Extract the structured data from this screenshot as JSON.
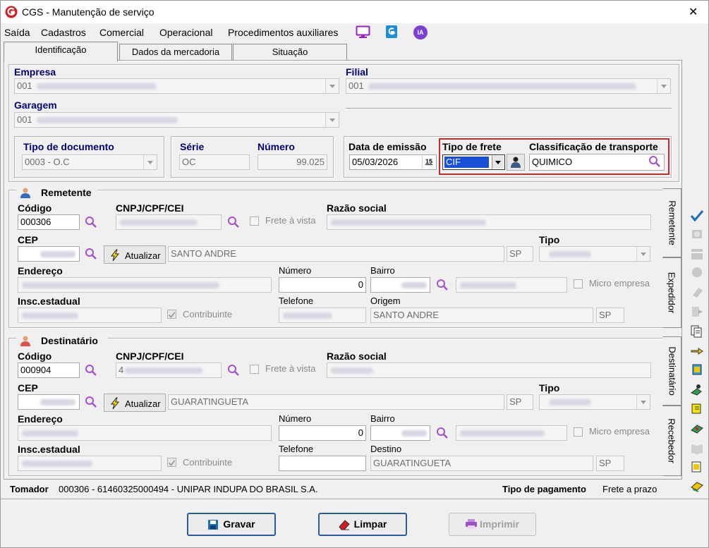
{
  "window": {
    "title": "CGS - Manutenção de serviço",
    "close": "✕"
  },
  "menu": {
    "items": [
      "Saída",
      "Cadastros",
      "Comercial",
      "Operacional",
      "Procedimentos auxiliares"
    ],
    "ia": "IA"
  },
  "tabs": [
    "Identificação",
    "Dados da mercadoria",
    "Situação"
  ],
  "company": {
    "empresa_label": "Empresa",
    "empresa_value": "001",
    "filial_label": "Filial",
    "filial_value": "001",
    "garagem_label": "Garagem",
    "garagem_value": "001"
  },
  "document": {
    "tipo_label": "Tipo de documento",
    "tipo_value": "0003 - O.C",
    "serie_label": "Série",
    "serie_value": "OC",
    "numero_label": "Número",
    "numero_value": "99.025",
    "data_label": "Data de emissão",
    "data_value": "05/03/2026",
    "cal": "15",
    "frete_label": "Tipo de frete",
    "frete_value": "CIF",
    "class_label": "Classificação de transporte",
    "class_value": "QUIMICO"
  },
  "remetente": {
    "title": "Remetente",
    "codigo_label": "Código",
    "codigo_value": "000306",
    "cnpj_label": "CNPJ/CPF/CEI",
    "frete_vista": "Frete à vista",
    "razao_label": "Razão social",
    "cep_label": "CEP",
    "atualizar": "Atualizar",
    "cidade": "SANTO ANDRE",
    "uf": "SP",
    "tipo_label": "Tipo",
    "endereco_label": "Endereço",
    "numero_label": "Número",
    "numero_value": "0",
    "bairro_label": "Bairro",
    "micro": "Micro empresa",
    "insc_label": "Insc.estadual",
    "contribuinte": "Contribuinte",
    "telefone_label": "Telefone",
    "origem_label": "Origem",
    "origem_value": "SANTO ANDRE",
    "origem_uf": "SP"
  },
  "destinatario": {
    "title": "Destinatário",
    "codigo_label": "Código",
    "codigo_value": "000904",
    "cnpj_label": "CNPJ/CPF/CEI",
    "cnpj_prefix": "4",
    "frete_vista": "Frete à vista",
    "razao_label": "Razão social",
    "cep_label": "CEP",
    "atualizar": "Atualizar",
    "cidade": "GUARATINGUETA",
    "uf": "SP",
    "tipo_label": "Tipo",
    "endereco_label": "Endereço",
    "numero_label": "Número",
    "numero_value": "0",
    "bairro_label": "Bairro",
    "micro": "Micro empresa",
    "insc_label": "Insc.estadual",
    "contribuinte": "Contribuinte",
    "telefone_label": "Telefone",
    "destino_label": "Destino",
    "destino_value": "GUARATINGUETA",
    "destino_uf": "SP"
  },
  "vtabs": [
    "Remetente",
    "Expedidor",
    "Destinatário",
    "Recebedor"
  ],
  "footer": {
    "tomador_label": "Tomador",
    "tomador_value": "000306 - 61460325000494 - UNIPAR INDUPA DO BRASIL S.A.",
    "pagamento_label": "Tipo de pagamento",
    "pagamento_value": "Frete a prazo"
  },
  "buttons": {
    "gravar": "Gravar",
    "limpar": "Limpar",
    "imprimir": "Imprimir"
  },
  "colors": {
    "label_blue": "#00007a",
    "accent_border": "#c42b2b",
    "button_border": "#2a5aa8",
    "magnifier": "#a64fd0",
    "selection": "#1a4fd8"
  }
}
